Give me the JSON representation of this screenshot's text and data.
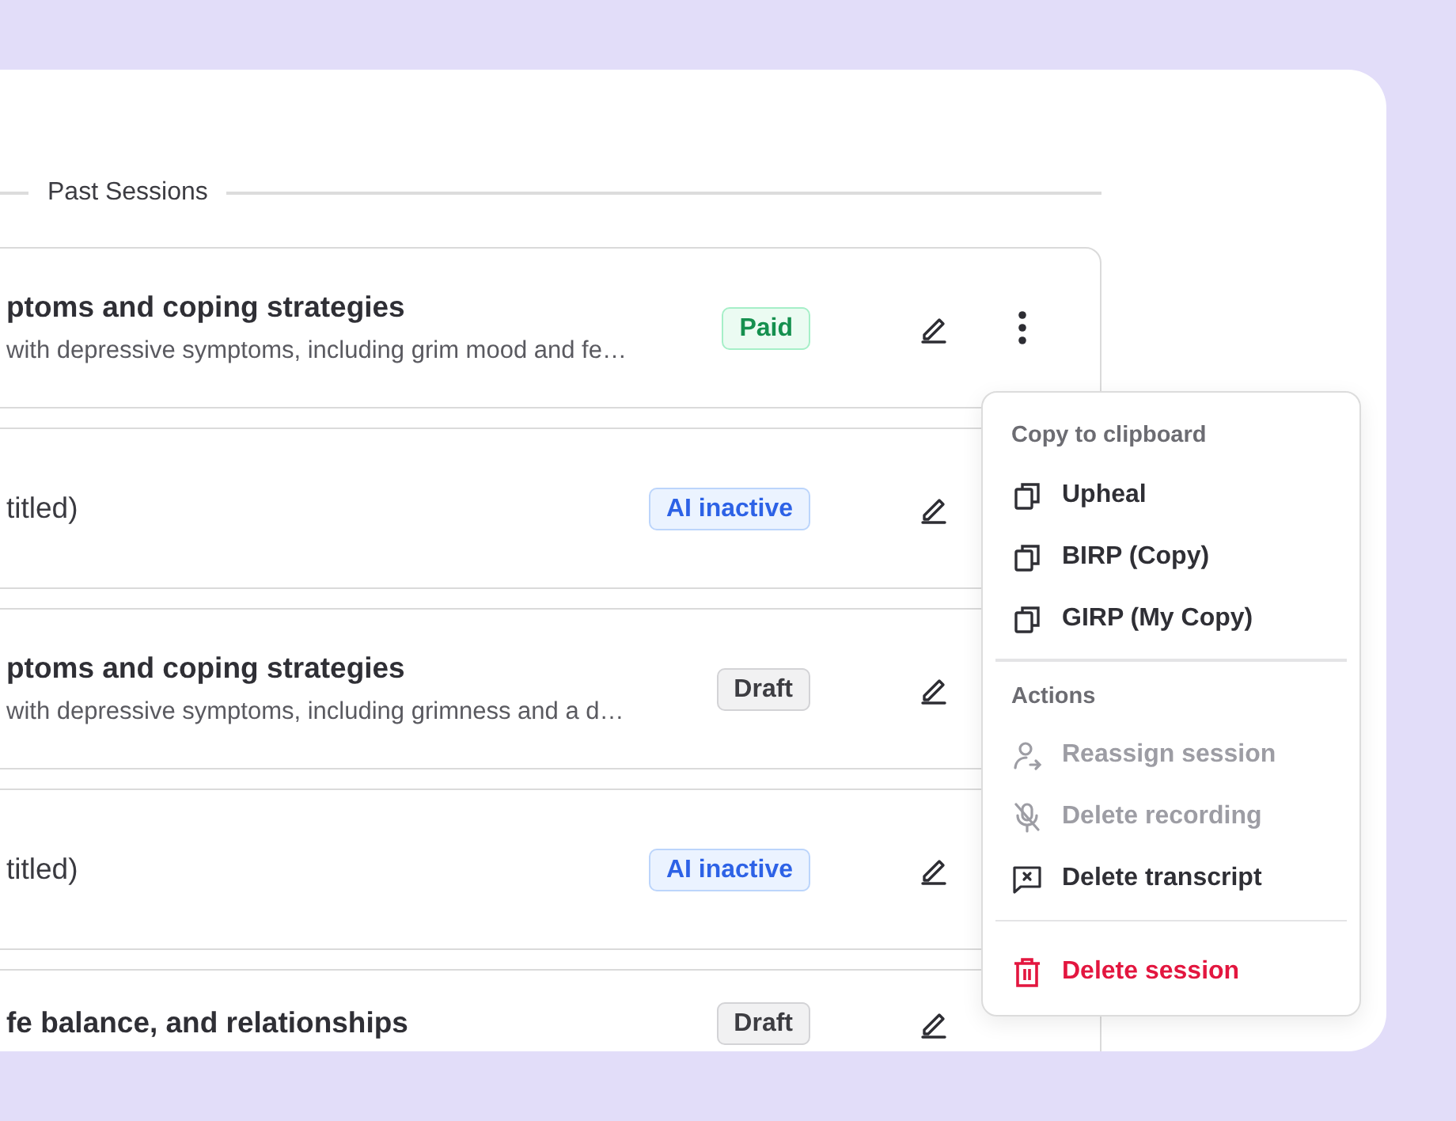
{
  "section_title": "Past Sessions",
  "sessions": [
    {
      "title": "ptoms and coping strategies",
      "untitled": false,
      "summary": "with depressive symptoms, including grim mood and fe…",
      "badge": {
        "label": "Paid",
        "kind": "paid"
      },
      "more_button": true
    },
    {
      "title": "titled)",
      "untitled": true,
      "badge": {
        "label": "AI inactive",
        "kind": "ai"
      },
      "more_button": false
    },
    {
      "title": "ptoms and coping strategies",
      "untitled": false,
      "summary": "with depressive symptoms, including grimness and a d…",
      "badge": {
        "label": "Draft",
        "kind": "draft"
      },
      "more_button": false
    },
    {
      "title": "titled)",
      "untitled": true,
      "badge": {
        "label": "AI inactive",
        "kind": "ai"
      },
      "more_button": false
    },
    {
      "title": "fe balance, and relationships",
      "untitled": false,
      "badge": {
        "label": "Draft",
        "kind": "draft"
      },
      "more_button": false
    }
  ],
  "menu": {
    "sections": [
      {
        "header": "Copy to clipboard",
        "items": [
          {
            "label": "Upheal",
            "kind": "copy",
            "disabled": false
          },
          {
            "label": "BIRP (Copy)",
            "kind": "copy",
            "disabled": false
          },
          {
            "label": "GIRP (My Copy)",
            "kind": "copy",
            "disabled": false
          }
        ]
      },
      {
        "header": "Actions",
        "items": [
          {
            "label": "Reassign session",
            "kind": "reassign",
            "disabled": true
          },
          {
            "label": "Delete recording",
            "kind": "mic",
            "disabled": true
          },
          {
            "label": "Delete transcript",
            "kind": "transcript",
            "disabled": false
          }
        ]
      },
      {
        "items": [
          {
            "label": "Delete session",
            "kind": "danger",
            "disabled": false
          }
        ]
      }
    ]
  }
}
